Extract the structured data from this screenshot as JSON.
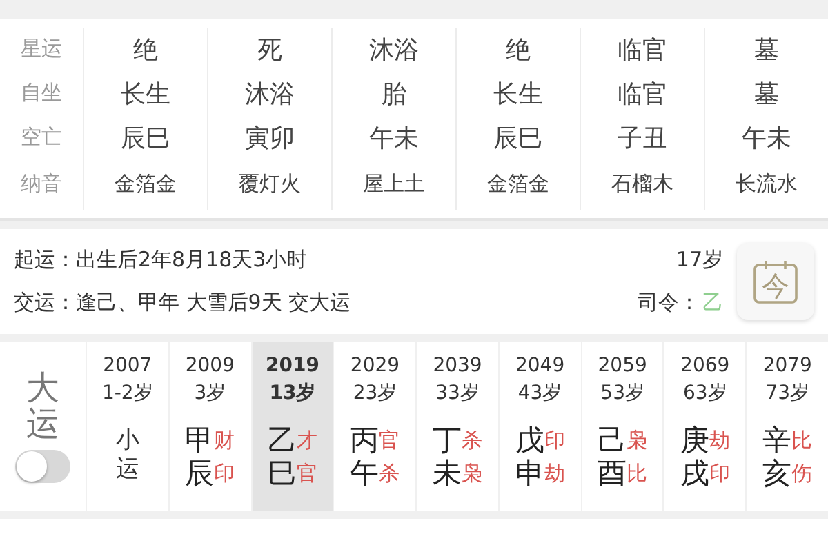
{
  "pillars_table": {
    "rows": [
      {
        "label": "星运",
        "cells": [
          "绝",
          "死",
          "沐浴",
          "绝",
          "临官",
          "墓"
        ]
      },
      {
        "label": "自坐",
        "cells": [
          "长生",
          "沐浴",
          "胎",
          "长生",
          "临官",
          "墓"
        ]
      },
      {
        "label": "空亡",
        "cells": [
          "辰巳",
          "寅卯",
          "午未",
          "辰巳",
          "子丑",
          "午未"
        ]
      },
      {
        "label": "纳音",
        "cells": [
          "金箔金",
          "覆灯火",
          "屋上土",
          "金箔金",
          "石榴木",
          "长流水"
        ]
      }
    ]
  },
  "start_info": {
    "lines": [
      {
        "label": "起运：",
        "text": "出生后2年8月18天3小时"
      },
      {
        "label": "交运：",
        "text": "逢己、甲年 大雪后9天 交大运"
      }
    ],
    "age": "17岁",
    "commander": {
      "label": "司令：",
      "value": "乙",
      "color": "#8fcf8f"
    },
    "today_button": {
      "label": "今"
    }
  },
  "luck": {
    "title": "大运",
    "toggle": {
      "on": false
    },
    "periods": [
      {
        "kind": "minor",
        "year": "2007",
        "age": "1-2岁",
        "text": "小运",
        "selected": false
      },
      {
        "kind": "major",
        "year": "2009",
        "age": "3岁",
        "stem": "甲",
        "branch": "辰",
        "stem_god": "财",
        "branch_god": "印",
        "selected": false
      },
      {
        "kind": "major",
        "year": "2019",
        "age": "13岁",
        "stem": "乙",
        "branch": "巳",
        "stem_god": "才",
        "branch_god": "官",
        "selected": true
      },
      {
        "kind": "major",
        "year": "2029",
        "age": "23岁",
        "stem": "丙",
        "branch": "午",
        "stem_god": "官",
        "branch_god": "杀",
        "selected": false
      },
      {
        "kind": "major",
        "year": "2039",
        "age": "33岁",
        "stem": "丁",
        "branch": "未",
        "stem_god": "杀",
        "branch_god": "枭",
        "selected": false
      },
      {
        "kind": "major",
        "year": "2049",
        "age": "43岁",
        "stem": "戊",
        "branch": "申",
        "stem_god": "印",
        "branch_god": "劫",
        "selected": false
      },
      {
        "kind": "major",
        "year": "2059",
        "age": "53岁",
        "stem": "己",
        "branch": "酉",
        "stem_god": "枭",
        "branch_god": "比",
        "selected": false
      },
      {
        "kind": "major",
        "year": "2069",
        "age": "63岁",
        "stem": "庚",
        "branch": "戌",
        "stem_god": "劫",
        "branch_god": "印",
        "selected": false
      },
      {
        "kind": "major",
        "year": "2079",
        "age": "73岁",
        "stem": "辛",
        "branch": "亥",
        "stem_god": "比",
        "branch_god": "伤",
        "selected": false
      }
    ]
  }
}
